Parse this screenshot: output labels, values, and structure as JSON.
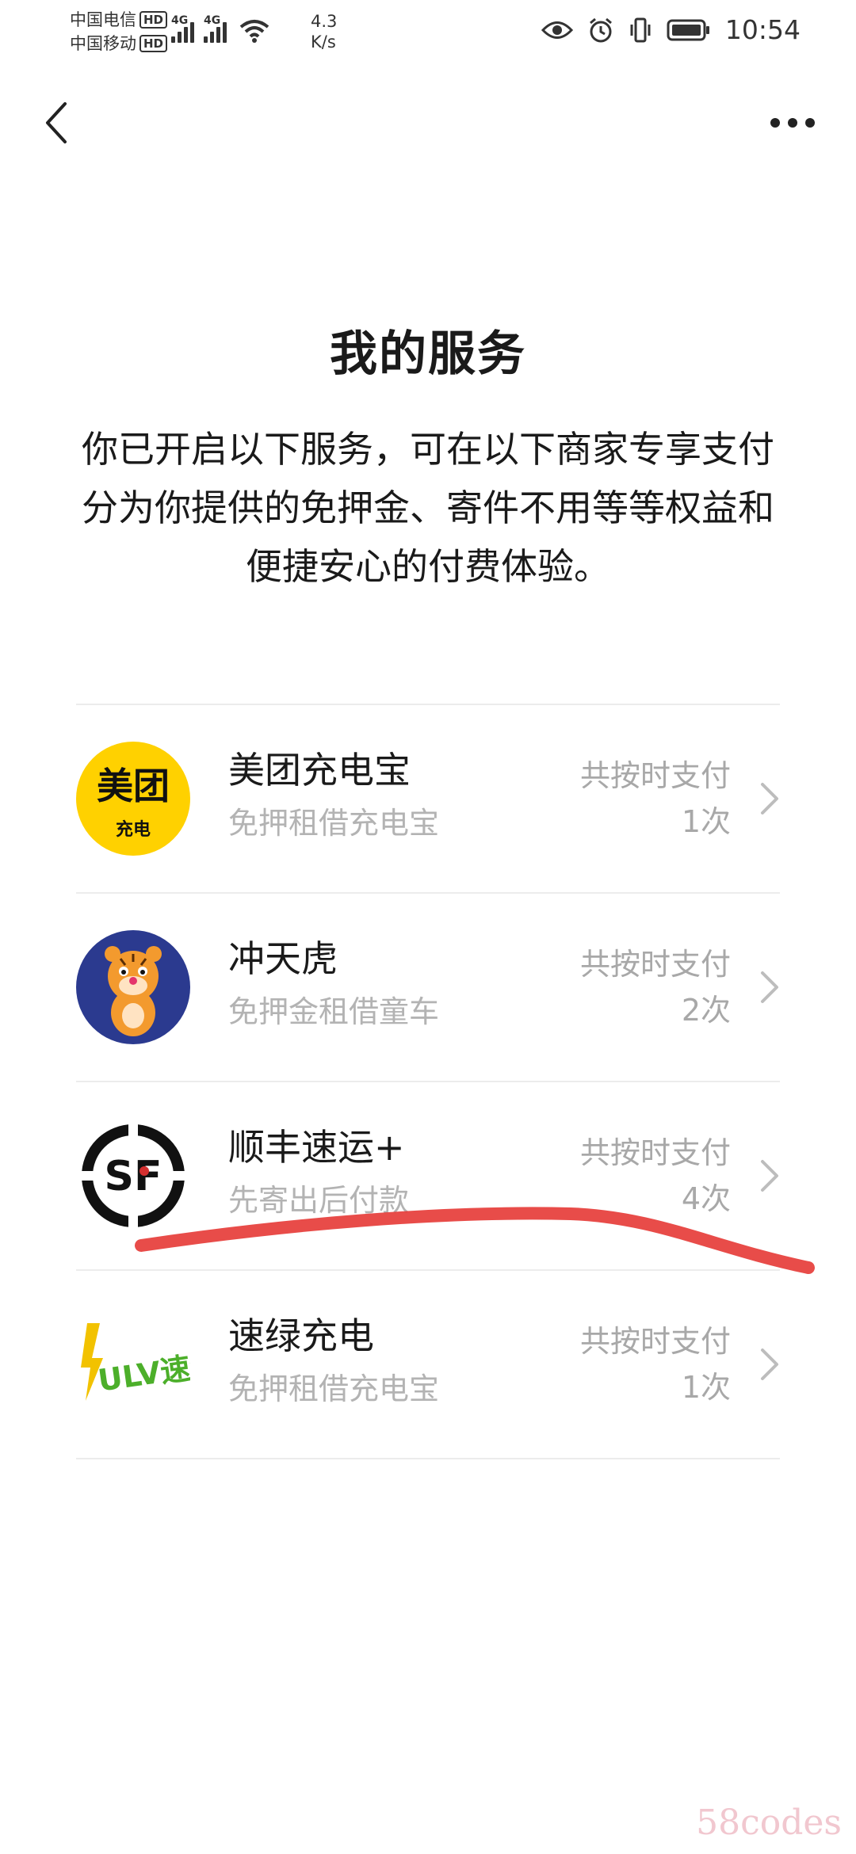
{
  "status_bar": {
    "carrier1": "中国电信",
    "carrier2": "中国移动",
    "hd_label": "HD",
    "network1": "4G",
    "network2": "4G",
    "speed_value": "4.3",
    "speed_unit": "K/s",
    "time": "10:54",
    "icons": [
      "eye-icon",
      "alarm-icon",
      "vibrate-icon",
      "battery-icon"
    ]
  },
  "header": {
    "back_icon": "chevron-left-icon",
    "more_icon": "more-dots-icon"
  },
  "page": {
    "title": "我的服务",
    "description": "你已开启以下服务，可在以下商家专享支付分为你提供的免押金、寄件不用等等权益和便捷安心的付费体验。"
  },
  "services": [
    {
      "name": "美团充电宝",
      "desc": "免押租借充电宝",
      "count": "共按时支付1次",
      "logo_text": "美团",
      "logo_sub": "充电",
      "logo_color": "#FFD100"
    },
    {
      "name": "冲天虎",
      "desc": "免押金租借童车",
      "count": "共按时支付2次",
      "logo_color": "#2B3A8F"
    },
    {
      "name": "顺丰速运+",
      "desc": "先寄出后付款",
      "count": "共按时支付4次",
      "logo_text": "SF",
      "logo_color": "#111111"
    },
    {
      "name": "速绿充电",
      "desc": "免押租借充电宝",
      "count": "共按时支付1次",
      "logo_text": "ULV速绿",
      "logo_color": "#4CAF2A"
    }
  ],
  "annotation": {
    "stroke_color": "#E53935"
  },
  "watermark": "58codes"
}
